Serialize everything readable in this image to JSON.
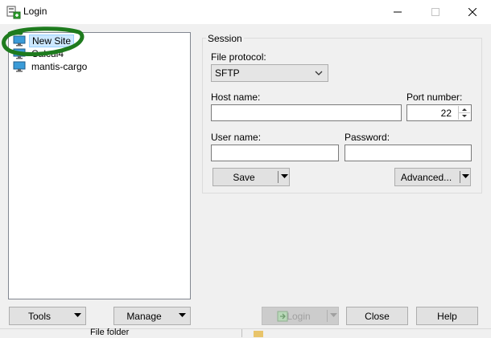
{
  "window": {
    "title": "Login"
  },
  "tree": {
    "items": [
      {
        "label": "New Site",
        "selected": true
      },
      {
        "label": "Calcul4",
        "selected": false
      },
      {
        "label": "mantis-cargo",
        "selected": false
      }
    ]
  },
  "session": {
    "group_title": "Session",
    "file_protocol_label": "File protocol:",
    "file_protocol_value": "SFTP",
    "host_label": "Host name:",
    "host_value": "",
    "port_label": "Port number:",
    "port_value": "22",
    "user_label": "User name:",
    "user_value": "",
    "password_label": "Password:",
    "password_value": "",
    "save_label": "Save",
    "advanced_label": "Advanced..."
  },
  "footer": {
    "tools_label": "Tools",
    "manage_label": "Manage",
    "login_label": "Login",
    "close_label": "Close",
    "help_label": "Help"
  },
  "background_strip": {
    "text": "File folder"
  },
  "colors": {
    "selection": "#cce8ff",
    "marker": "#1e7b1e",
    "accent": "#0078d7"
  }
}
